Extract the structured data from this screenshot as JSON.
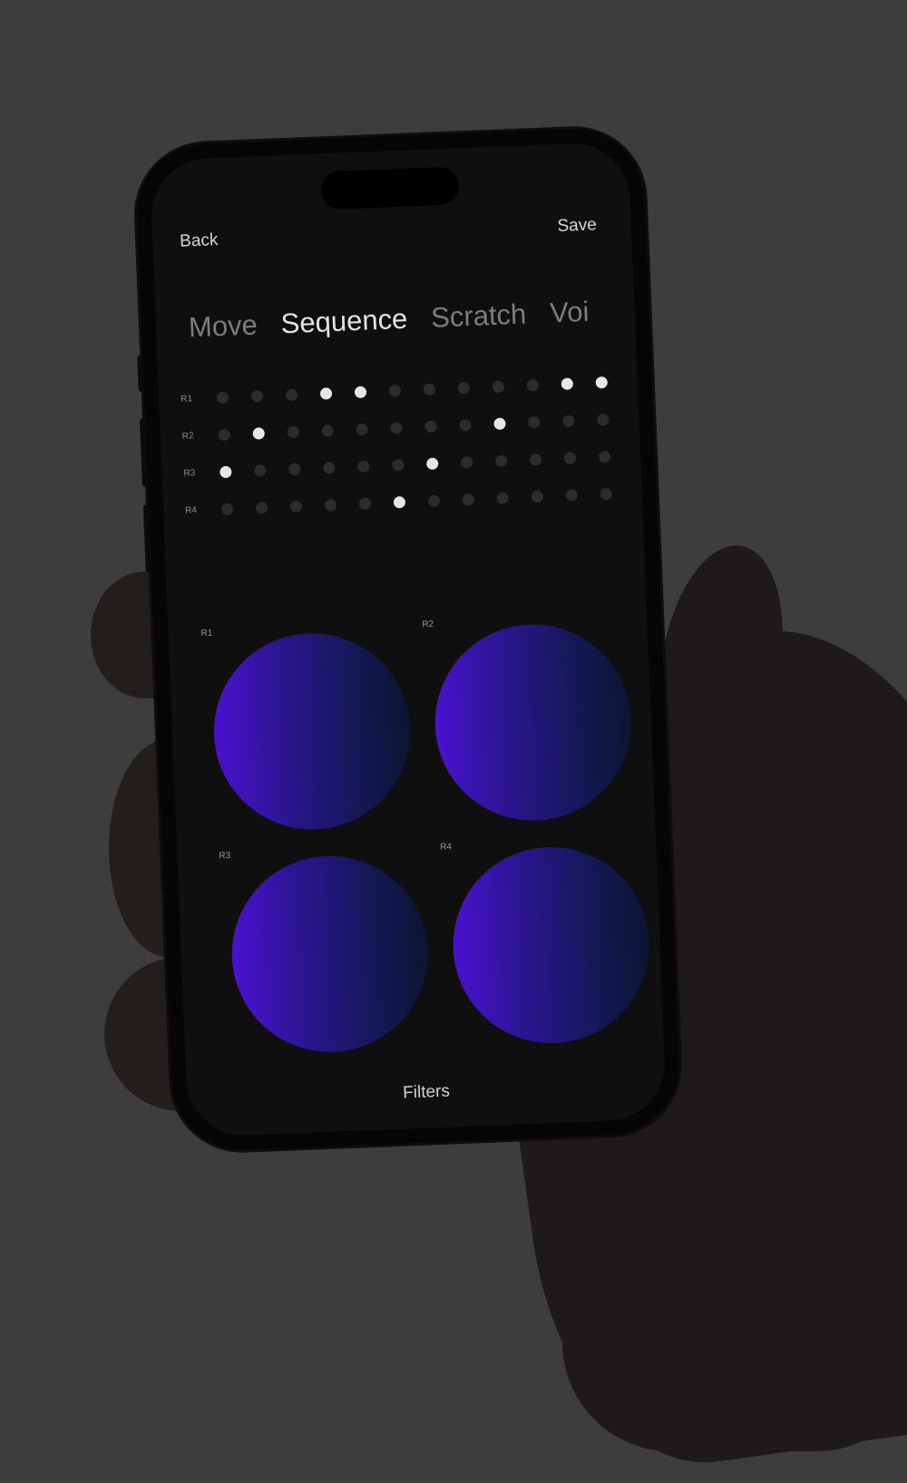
{
  "header": {
    "back_label": "Back",
    "save_label": "Save"
  },
  "tabs": [
    {
      "label": "Move",
      "active": false
    },
    {
      "label": "Sequence",
      "active": true
    },
    {
      "label": "Scratch",
      "active": false
    },
    {
      "label": "Voi",
      "active": false
    }
  ],
  "sequence": {
    "steps": 12,
    "rows": [
      {
        "label": "R1",
        "active_steps": [
          4,
          5,
          11,
          12
        ]
      },
      {
        "label": "R2",
        "active_steps": [
          2,
          9
        ]
      },
      {
        "label": "R3",
        "active_steps": [
          1,
          7
        ]
      },
      {
        "label": "R4",
        "active_steps": [
          6
        ]
      }
    ]
  },
  "pads": [
    {
      "label": "R1"
    },
    {
      "label": "R2"
    },
    {
      "label": "R3"
    },
    {
      "label": "R4"
    }
  ],
  "footer": {
    "filters_label": "Filters"
  },
  "colors": {
    "pad_gradient_start": "#4a12d0",
    "pad_gradient_end": "#0b1630",
    "active_dot": "#e6e6e6",
    "inactive_dot": "#2c2c2c",
    "screen_bg": "#0f0f0f",
    "page_bg": "#3d3d3d"
  }
}
